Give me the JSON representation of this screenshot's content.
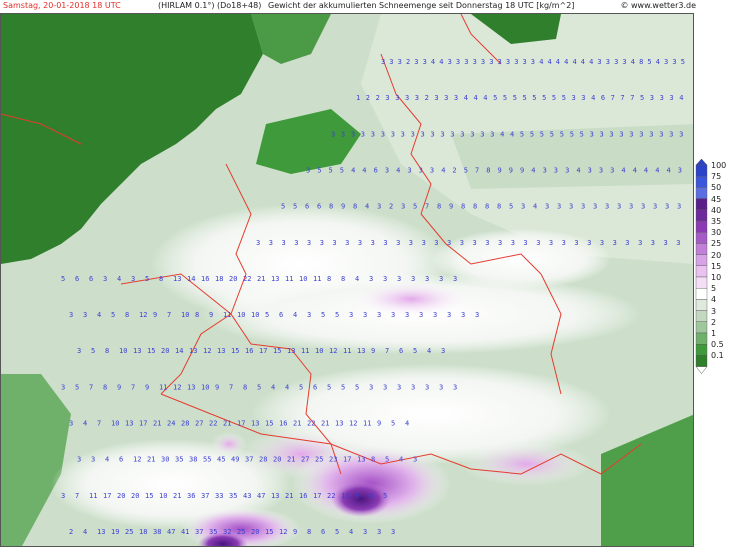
{
  "header": {
    "date_label": "Samstag, 20-01-2018   18 UTC",
    "model_label": "(HIRLAM 0.1°) (Do18+48)",
    "description": "Gewicht der akkumulierten Schneemenge seit Donnerstag 18 UTC [kg/m^2]",
    "site": "© www.wetter3.de"
  },
  "legend": {
    "levels": [
      {
        "label": "100",
        "color": "#2a43c8"
      },
      {
        "label": "75",
        "color": "#3a56dc"
      },
      {
        "label": "50",
        "color": "#5b6fe3"
      },
      {
        "label": "45",
        "color": "#5a1f8a"
      },
      {
        "label": "40",
        "color": "#6e2a9c"
      },
      {
        "label": "35",
        "color": "#8a3bb3"
      },
      {
        "label": "30",
        "color": "#a65ac6"
      },
      {
        "label": "25",
        "color": "#c27fd9"
      },
      {
        "label": "20",
        "color": "#d8a3e6"
      },
      {
        "label": "15",
        "color": "#e9c2ef"
      },
      {
        "label": "10",
        "color": "#f4def6"
      },
      {
        "label": "5",
        "color": "#ffffff"
      },
      {
        "label": "4",
        "color": "#dfe9dd"
      },
      {
        "label": "3",
        "color": "#c2d9c0"
      },
      {
        "label": "2",
        "color": "#9fc79c"
      },
      {
        "label": "1",
        "color": "#6fb06b"
      },
      {
        "label": "0.5",
        "color": "#3f9a3b"
      },
      {
        "label": "0.1",
        "color": "#2d7f2a"
      }
    ]
  },
  "map": {
    "sea_color": "#2f7f2c",
    "land_base_color": "#cddfcb",
    "border_color": "#e53b2e",
    "value_color": "#3b3fd1",
    "value_rows": [
      {
        "row": "3 3 3 2 3 3 4 4 3 3 3 3 3 3 3 3 3 3 3 4 4 4 4 4 4 4 3 3 3 3 4 8 5 4 3 3 5"
      },
      {
        "row": "1 2 2 3 3 3 3 2 3 3 3 4 4 4 5 5 5 5 5 5 5 5 3 3 4 6 7 7 7 5 3 3 3 4"
      },
      {
        "row": "3 3 3 3 3 3 3 3 3 3 3 3 3 3 3 3 3 4 4 5 5 5 5 5 5 5 3 3 3 3 3 3 3 3 3 3"
      },
      {
        "row": "3 5 5 5 4 4 6 3 4 3 3 3 4 2 5 7 8 9 9 9 4 3 3 3 4 3 3 3 4 4 4 4 4 3"
      },
      {
        "row": "5 5 6 6 8 9 8 4 3 2 3 5 7 8 9 8 8 8 8 5 3 4 3 3 3 3 3 3 3 3 3 3 3 3"
      },
      {
        "row": "3 3 3 3 3 3 3 3 3 3 3 3 3 3 3 3 3 3 3 3 3 3 3 3 3 3 3 3 3 3 3 3 3 3"
      },
      {
        "row": "5 6 6 3 4 3 5 8 13 14 16 18 20 22 21 13 11 10 11 8 8 4 3 3 3 3 3 3 3"
      },
      {
        "row": "3 3 4 5 8 12 9 7 10 8 9 11 10 10 5 6 4 3 5 5 3 3 3 3 3 3 3 3 3 3"
      },
      {
        "row": "3 5 8 10 13 15 20 14 13 12 13 15 16 17 15 13 11 10 12 11 13 9 7 6 5 4 3"
      },
      {
        "row": "3 5 7 8 9 7 9 11 12 13 10 9 7 8 5 4 4 5 6 5 5 5 3 3 3 3 3 3 3"
      },
      {
        "row": "3 4 7 10 13 17 21 24 28 27 22 21 17 13 15 16 21 22 21 13 12 11 9 5 4"
      },
      {
        "row": "3 3 4 6 12 21 30 35 38 55 45 49 37 28 20 21 27 25 23 17 13 8 5 4 3"
      },
      {
        "row": "3 7 11 17 20 20 15 10 21 36 37 33 35 43 47 13 21 16 17 22 13 9 6 5"
      },
      {
        "row": "2 4 13 19 25 18 38 47 41 37 35 32 25 20 15 12 9 8 6 5 4 3 3 3"
      }
    ]
  }
}
